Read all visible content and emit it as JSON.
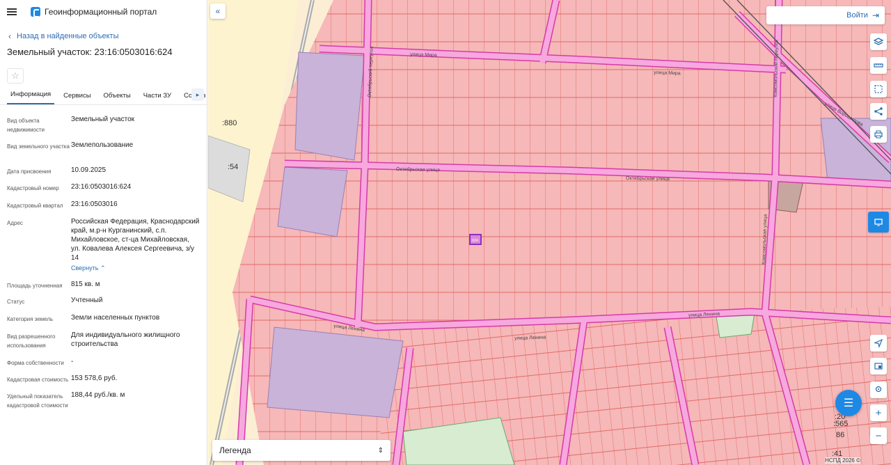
{
  "header": {
    "portal_name": "Геоинформационный портал"
  },
  "nav": {
    "back_label": "Назад в найденные объекты"
  },
  "object": {
    "title": "Земельный участок: 23:16:0503016:624"
  },
  "tabs": [
    {
      "label": "Информация"
    },
    {
      "label": "Сервисы"
    },
    {
      "label": "Объекты"
    },
    {
      "label": "Части ЗУ"
    },
    {
      "label": "Состав"
    }
  ],
  "properties": [
    {
      "label": "Вид объекта недвижимости",
      "value": "Земельный участок"
    },
    {
      "label": "Вид земельного участка",
      "value": "Землепользование"
    },
    {
      "label": "Дата присвоения",
      "value": "10.09.2025"
    },
    {
      "label": "Кадастровый номер",
      "value": "23:16:0503016:624"
    },
    {
      "label": "Кадастровый квартал",
      "value": "23:16:0503016"
    },
    {
      "label": "Адрес",
      "value": "Российская Федерация, Краснодарский край, м.р-н Курганинский, с.п. Михайловское, ст-ца Михайловская, ул. Ковалева Алексея Сергеевича, з/у 14"
    },
    {
      "label": "Площадь уточненная",
      "value": "815 кв. м"
    },
    {
      "label": "Статус",
      "value": "Учтенный"
    },
    {
      "label": "Категория земель",
      "value": "Земли населенных пунктов"
    },
    {
      "label": "Вид разрешенного использования",
      "value": "Для индивидуального жилищного строительства"
    },
    {
      "label": "Форма собственности",
      "value": "-"
    },
    {
      "label": "Кадастровая стоимость",
      "value": "153 578,6 руб."
    },
    {
      "label": "Удельный показатель кадастровой стоимости",
      "value": "188,44 руб./кв. м"
    }
  ],
  "collapse_label": "Свернуть",
  "map": {
    "login_label": "Войти",
    "legend_label": "Легенда",
    "copyright": "НСПД 2026 ©",
    "streets": [
      "улица Мира",
      "улица Мира",
      "Октябрьская улица",
      "Октябрьская улица",
      "улица Ленина",
      "улица Ленина",
      "улица Ленина",
      "Октябрьский переулок",
      "Комсомольский переулок",
      "Комсомольская улица",
      "улица Ворошилова"
    ],
    "labels": [
      ":880",
      ":54",
      ":565",
      "86",
      ":41",
      ":20",
      ":624"
    ],
    "colors": {
      "parcel_fill": "#f5b6b6",
      "parcel_stroke": "#d9534f",
      "road": "#f48fd0",
      "road_edge": "#d63aa8",
      "highlight": "#8b2fc9",
      "accent": "#2b6cb0"
    }
  },
  "icons": [
    "menu-icon",
    "logo-icon",
    "chevron-left-icon",
    "star-icon",
    "chevron-right-icon",
    "collapse-panel-icon",
    "login-icon",
    "layers-icon",
    "ruler-icon",
    "select-area-icon",
    "share-icon",
    "print-icon",
    "locate-icon",
    "screen-icon",
    "location-pin-icon",
    "zoom-in-icon",
    "zoom-out-icon",
    "chat-icon",
    "chevron-updown-icon"
  ]
}
